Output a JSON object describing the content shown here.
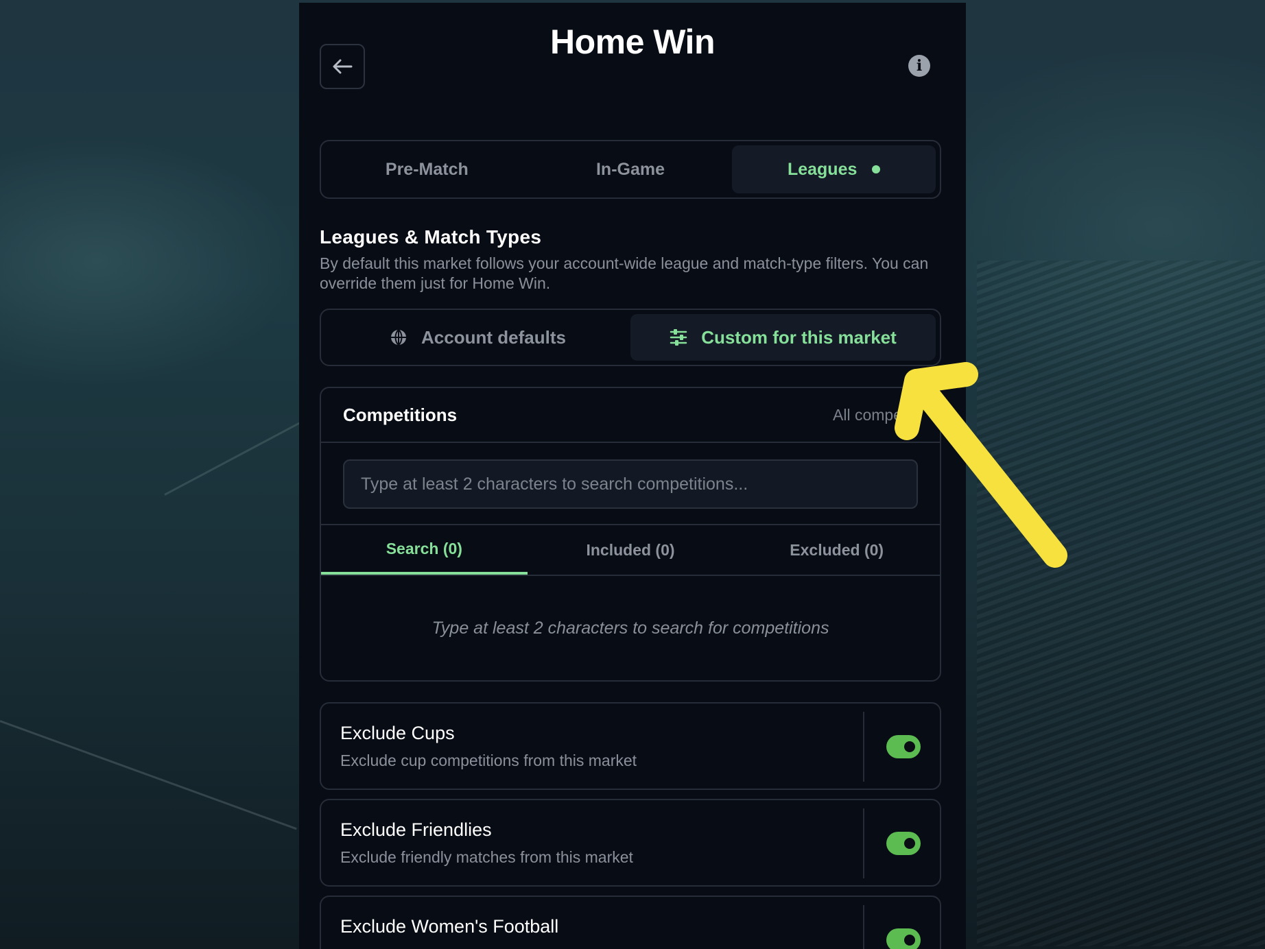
{
  "header": {
    "title": "Home Win",
    "back_icon": "arrow-left-icon",
    "info_icon": "info-icon"
  },
  "main_tabs": [
    {
      "label": "Pre-Match",
      "active": false
    },
    {
      "label": "In-Game",
      "active": false
    },
    {
      "label": "Leagues",
      "active": true
    }
  ],
  "section": {
    "title": "Leagues & Match Types",
    "description": "By default this market follows your account-wide league and match-type filters. You can override them just for Home Win."
  },
  "mode": {
    "options": [
      {
        "label": "Account defaults",
        "icon": "globe-icon",
        "active": false
      },
      {
        "label": "Custom for this market",
        "icon": "sliders-icon",
        "active": true
      }
    ]
  },
  "competitions": {
    "title": "Competitions",
    "summary": "All competiti",
    "search_placeholder": "Type at least 2 characters to search competitions...",
    "tabs": [
      {
        "label": "Search (0)",
        "active": true
      },
      {
        "label": "Included (0)",
        "active": false
      },
      {
        "label": "Excluded (0)",
        "active": false
      }
    ],
    "empty_message": "Type at least 2 characters to search for competitions"
  },
  "toggles": [
    {
      "title": "Exclude Cups",
      "description": "Exclude cup competitions from this market",
      "on": true
    },
    {
      "title": "Exclude Friendlies",
      "description": "Exclude friendly matches from this market",
      "on": true
    },
    {
      "title": "Exclude Women's Football",
      "description": "",
      "on": true
    }
  ],
  "colors": {
    "accent": "#86e09a",
    "toggle_on": "#5cbc52",
    "panel_bg": "#080c14",
    "annotation_arrow": "#f7e13f"
  }
}
